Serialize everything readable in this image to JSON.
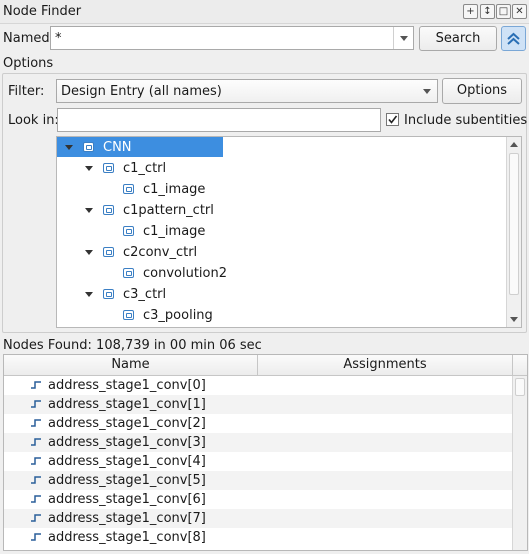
{
  "window": {
    "title": "Node Finder"
  },
  "named": {
    "label": "Named:",
    "value": "*",
    "search_button": "Search",
    "collapse_icon": "double-chevron-up-icon"
  },
  "options": {
    "section_label": "Options",
    "filter_label": "Filter:",
    "filter_value": "Design Entry (all names)",
    "options_button": "Options",
    "lookin_label": "Look in:",
    "lookin_value": "",
    "include_subentities_label": "Include subentities",
    "include_subentities_checked": true
  },
  "tree": {
    "items": [
      {
        "label": "CNN",
        "level": 0,
        "expanded": true,
        "selected": true
      },
      {
        "label": "c1_ctrl",
        "level": 1,
        "expanded": true
      },
      {
        "label": "c1_image",
        "level": 2
      },
      {
        "label": "c1pattern_ctrl",
        "level": 1,
        "expanded": true
      },
      {
        "label": "c1_image",
        "level": 2
      },
      {
        "label": "c2conv_ctrl",
        "level": 1,
        "expanded": true
      },
      {
        "label": "convolution2",
        "level": 2
      },
      {
        "label": "c3_ctrl",
        "level": 1,
        "expanded": true
      },
      {
        "label": "c3_pooling",
        "level": 2
      }
    ]
  },
  "results": {
    "summary": "Nodes Found: 108,739 in 00 min 06 sec",
    "columns": [
      "Name",
      "Assignments"
    ],
    "rows": [
      "address_stage1_conv[0]",
      "address_stage1_conv[1]",
      "address_stage1_conv[2]",
      "address_stage1_conv[3]",
      "address_stage1_conv[4]",
      "address_stage1_conv[5]",
      "address_stage1_conv[6]",
      "address_stage1_conv[7]",
      "address_stage1_conv[8]"
    ]
  },
  "colors": {
    "selection": "#3d8ee0",
    "accent_button": "#d7e6f5"
  }
}
